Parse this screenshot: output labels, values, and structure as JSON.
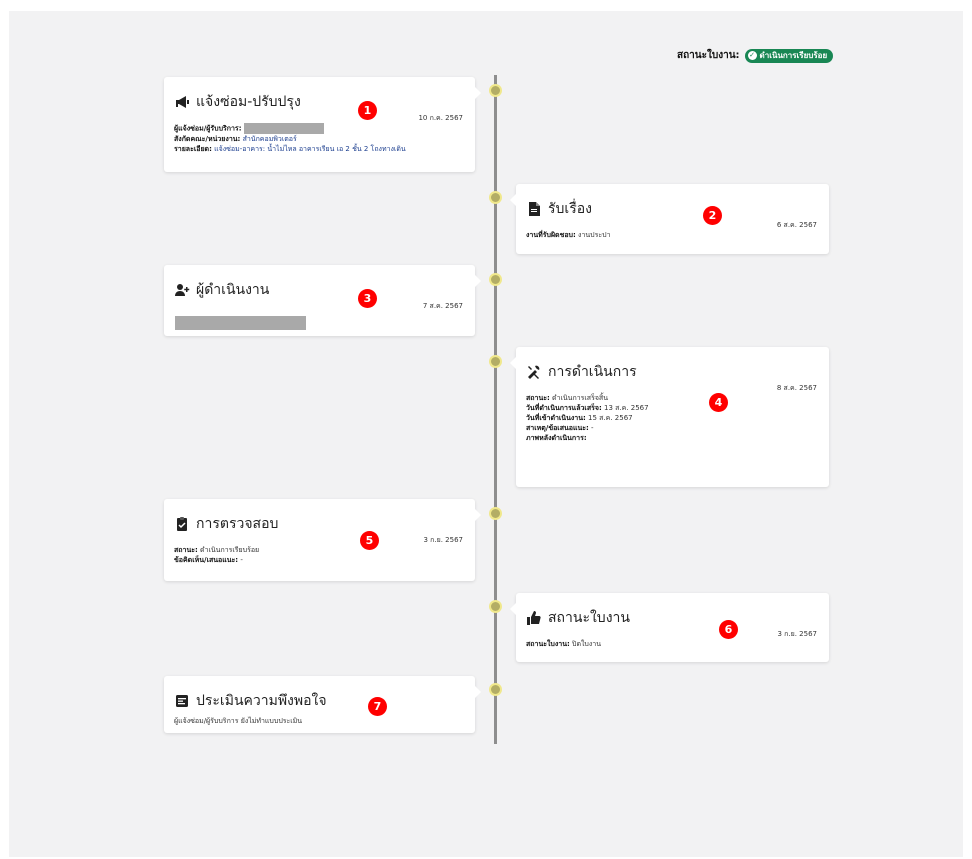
{
  "header": {
    "status_label": "สถานะใบงาน:",
    "status_badge": "ดำเนินการเรียบร้อย",
    "status_color": "#198754"
  },
  "cards": {
    "report": {
      "title": "แจ้งซ่อม-ปรับปรุง",
      "date": "10 ก.ค. 2567",
      "requester_label": "ผู้แจ้งซ่อม/ผู้รับบริการ:",
      "dept_label": "สังกัดคณะ/หน่วยงาน:",
      "dept_value": "สำนักคอมพิวเตอร์",
      "detail_label": "รายละเอียด:",
      "detail_value": "แจ้งซ่อม-อาคาร: น้ำไม่ไหล อาคารเรียน เอ 2 ชั้น 2 โถงทางเดิน",
      "marker": "1"
    },
    "receive": {
      "title": "รับเรื่อง",
      "date": "6 ส.ค. 2567",
      "resp_label": "งานที่รับผิดชอบ:",
      "resp_value": "งานประปา",
      "marker": "2"
    },
    "operator": {
      "title": "ผู้ดำเนินงาน",
      "date": "7 ส.ค. 2567",
      "marker": "3"
    },
    "operation": {
      "title": "การดำเนินการ",
      "date": "8 ส.ค. 2567",
      "status_label": "สถานะ:",
      "status_value": "ดำเนินการเสร็จสิ้น",
      "done_label": "วันที่ดำเนินการแล้วเสร็จ:",
      "done_value": "13 ส.ค. 2567",
      "enter_label": "วันที่เข้าดำเนินงาน:",
      "enter_value": "15 ส.ค. 2567",
      "cause_label": "สาเหตุ/ข้อเสนอแนะ:",
      "cause_value": "-",
      "photo_label": "ภาพหลังดำเนินการ:",
      "marker": "4"
    },
    "inspect": {
      "title": "การตรวจสอบ",
      "date": "3 ก.ย. 2567",
      "status_label": "สถานะ:",
      "status_value": "ดำเนินการเรียบร้อย",
      "comment_label": "ข้อคิดเห็น/เสนอแนะ:",
      "comment_value": "-",
      "marker": "5"
    },
    "jobstatus": {
      "title": "สถานะใบงาน",
      "date": "3 ก.ย. 2567",
      "status_label": "สถานะใบงาน:",
      "status_value": "ปิดใบงาน",
      "marker": "6"
    },
    "satisfaction": {
      "title": "ประเมินความพึงพอใจ",
      "note": "ผู้แจ้งซ่อม/ผู้รับบริการ ยังไม่ทำแบบประเมิน",
      "marker": "7"
    }
  }
}
